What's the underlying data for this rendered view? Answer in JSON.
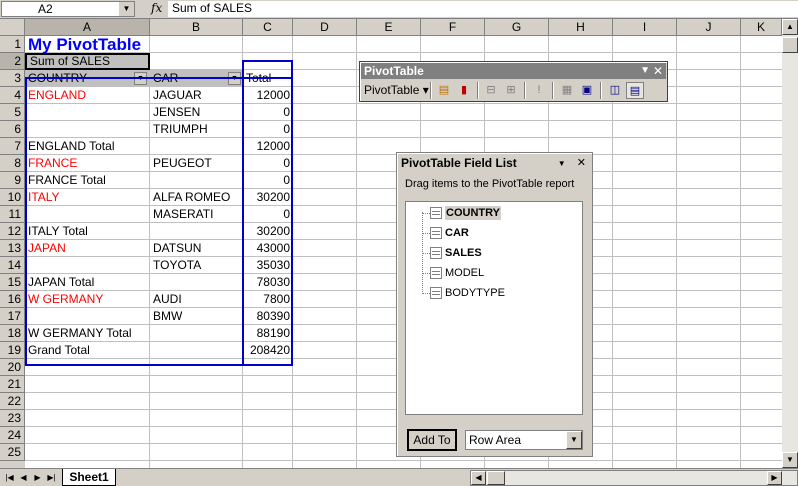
{
  "formula_bar": {
    "name_box": "A2",
    "fx": "fx",
    "formula": "Sum of SALES"
  },
  "columns": [
    "A",
    "B",
    "C",
    "D",
    "E",
    "F",
    "G",
    "H",
    "I",
    "J",
    "K"
  ],
  "rows": [
    "1",
    "2",
    "3",
    "4",
    "5",
    "6",
    "7",
    "8",
    "9",
    "10",
    "11",
    "12",
    "13",
    "14",
    "15",
    "16",
    "17",
    "18",
    "19",
    "20",
    "21",
    "22",
    "23",
    "24",
    "25"
  ],
  "sheet": {
    "title": "My PivotTable",
    "data_field": "Sum of SALES",
    "row_fields": [
      "COUNTRY",
      "CAR"
    ],
    "total_header": "Total",
    "body": [
      {
        "a": "ENGLAND",
        "b": "JAGUAR",
        "c": "12000",
        "red": true
      },
      {
        "a": "",
        "b": "JENSEN",
        "c": "0"
      },
      {
        "a": "",
        "b": "TRIUMPH",
        "c": "0"
      },
      {
        "a": "ENGLAND Total",
        "b": "",
        "c": "12000"
      },
      {
        "a": "FRANCE",
        "b": "PEUGEOT",
        "c": "0",
        "red": true
      },
      {
        "a": "FRANCE Total",
        "b": "",
        "c": "0"
      },
      {
        "a": "ITALY",
        "b": "ALFA ROMEO",
        "c": "30200",
        "red": true
      },
      {
        "a": "",
        "b": "MASERATI",
        "c": "0"
      },
      {
        "a": "ITALY Total",
        "b": "",
        "c": "30200"
      },
      {
        "a": "JAPAN",
        "b": "DATSUN",
        "c": "43000",
        "red": true
      },
      {
        "a": "",
        "b": "TOYOTA",
        "c": "35030"
      },
      {
        "a": "JAPAN Total",
        "b": "",
        "c": "78030"
      },
      {
        "a": "W GERMANY",
        "b": "AUDI",
        "c": "7800",
        "red": true
      },
      {
        "a": "",
        "b": "BMW",
        "c": "80390"
      },
      {
        "a": "W GERMANY Total",
        "b": "",
        "c": "88190"
      },
      {
        "a": "Grand Total",
        "b": "",
        "c": "208420"
      }
    ],
    "tab": "Sheet1"
  },
  "pivot_toolbar": {
    "title": "PivotTable",
    "menu": "PivotTable ▾"
  },
  "field_list": {
    "title": "PivotTable Field List",
    "description": "Drag items to the PivotTable report",
    "fields": [
      {
        "label": "COUNTRY",
        "bold": true,
        "highlight": true
      },
      {
        "label": "CAR",
        "bold": true
      },
      {
        "label": "SALES",
        "bold": true
      },
      {
        "label": "MODEL",
        "bold": false
      },
      {
        "label": "BODYTYPE",
        "bold": false
      }
    ],
    "add_to": "Add To",
    "area": "Row Area"
  },
  "colors": {
    "field_label_red": "#ff0000",
    "title_blue": "#0000ff",
    "pivot_border": "#0000cc"
  }
}
